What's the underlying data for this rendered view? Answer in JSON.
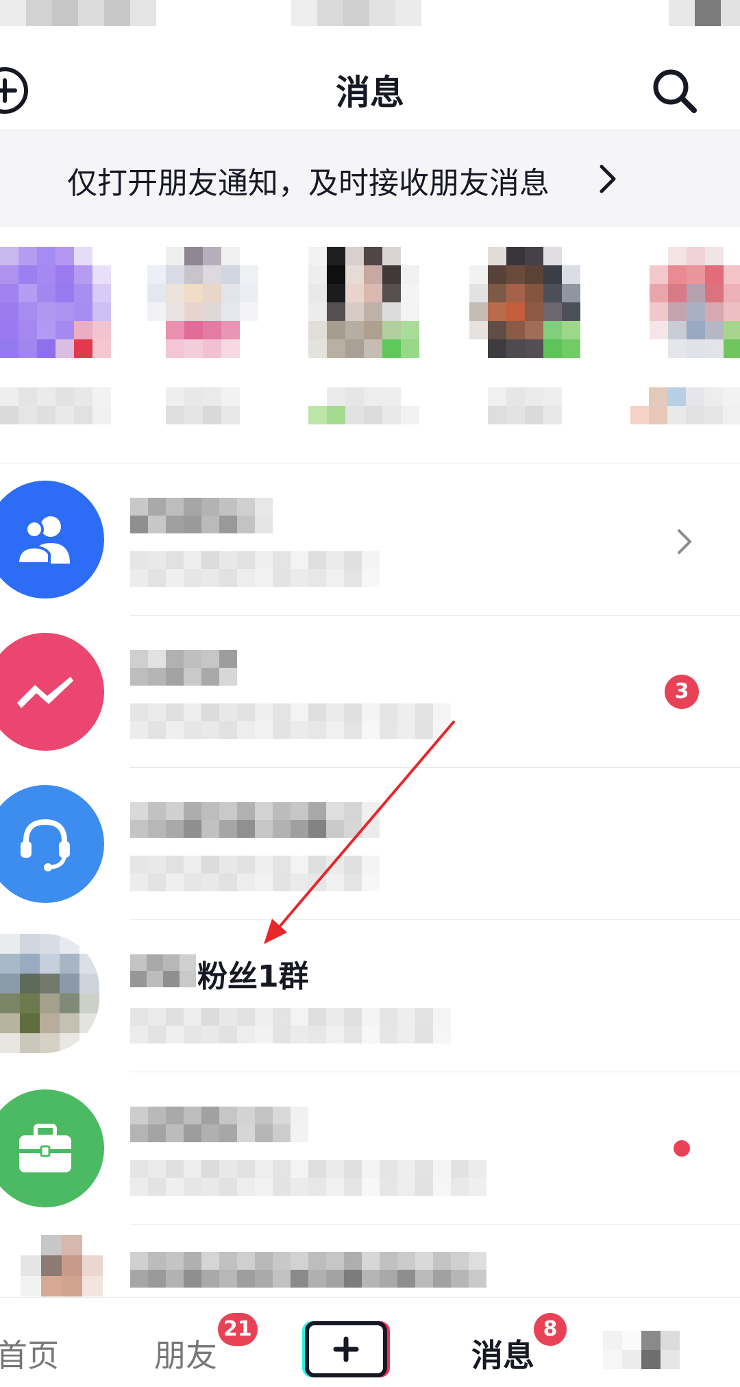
{
  "header": {
    "title": "消息",
    "add_icon": "add-circle-icon",
    "search_icon": "search-icon"
  },
  "banner": {
    "text": "仅打开朋友通知，及时接收朋友消息"
  },
  "conversations": [
    {
      "icon": "people-icon",
      "color": "#2d6df6",
      "trailing": "chevron"
    },
    {
      "icon": "lightning-icon",
      "color": "#ea4670",
      "trailing": "badge",
      "badge": "3"
    },
    {
      "icon": "headset-icon",
      "color": "#3d8cf0",
      "trailing": "none"
    },
    {
      "name_suffix": "粉丝1群",
      "trailing": "none"
    },
    {
      "icon": "briefcase-icon",
      "color": "#4cba62",
      "trailing": "dot"
    }
  ],
  "bottom_nav": {
    "items": [
      {
        "label": "首页"
      },
      {
        "label": "朋友",
        "badge": "21"
      },
      {
        "label": "消息",
        "badge": "8"
      }
    ]
  },
  "colors": {
    "badge": "#e94256",
    "arrow": "#e8262a"
  }
}
